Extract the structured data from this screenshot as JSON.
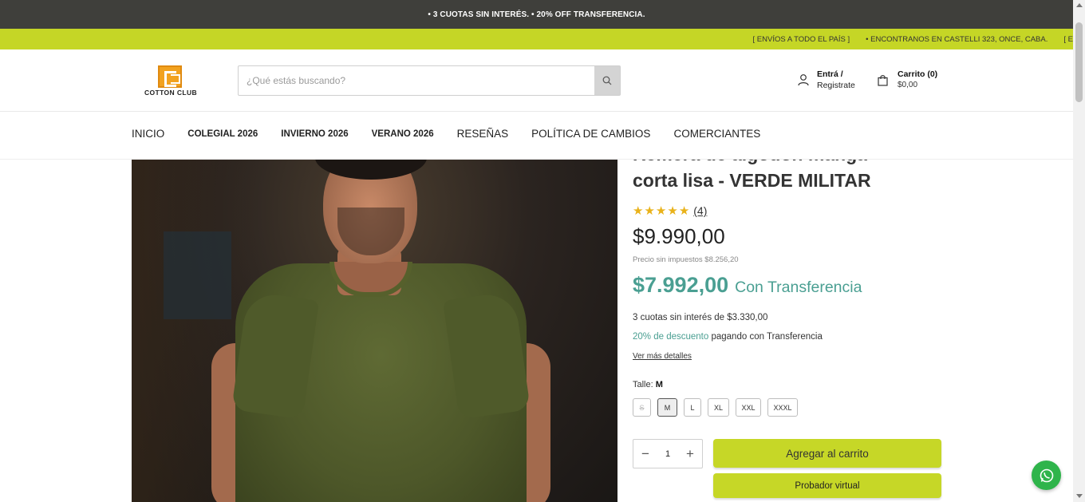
{
  "announcement": {
    "text": "• 3 CUOTAS SIN INTERÉS. • 20% OFF TRANSFERENCIA."
  },
  "ticker": {
    "items": [
      "[ ENVÍOS A TODO EL PAÍS ]",
      "• ENCONTRANOS EN CASTELLI 323, ONCE, CABA.",
      "[ E"
    ]
  },
  "header": {
    "logo_text": "COTTON CLUB",
    "search_placeholder": "¿Qué estás buscando?",
    "account": {
      "line1": "Entrá /",
      "line2": "Registrate"
    },
    "cart": {
      "line1": "Carrito (0)",
      "line2": "$0,00"
    }
  },
  "nav": {
    "items": [
      "INICIO",
      "COLEGIAL 2026",
      "INVIERNO 2026",
      "VERANO 2026",
      "RESEÑAS",
      "POLÍTICA DE CAMBIOS",
      "COMERCIANTES"
    ]
  },
  "product": {
    "title_line1_partial": "Remera de algodón manga",
    "title_line2": "corta lisa - VERDE MILITAR",
    "rating_count": "(4)",
    "stars": 5,
    "price": "$9.990,00",
    "price_no_tax": "Precio sin impuestos $8.256,20",
    "transfer_price": "$7.992,00",
    "transfer_label": "Con Transferencia",
    "installments": "3 cuotas sin interés de $3.330,00",
    "discount_highlight": "20% de descuento",
    "discount_rest": " pagando con Transferencia",
    "more_details": "Ver más detalles",
    "size_label": "Talle:",
    "size_selected": "M",
    "sizes": [
      "S",
      "M",
      "L",
      "XL",
      "XXL",
      "XXXL"
    ],
    "quantity": "1",
    "add_to_cart": "Agregar al carrito",
    "virtual_fitting": "Probador virtual"
  },
  "colors": {
    "accent": "#c6d727",
    "teal": "#4a9f92",
    "topbar": "#3f3f3b",
    "whatsapp": "#2fb44b",
    "star": "#e9b21a"
  }
}
